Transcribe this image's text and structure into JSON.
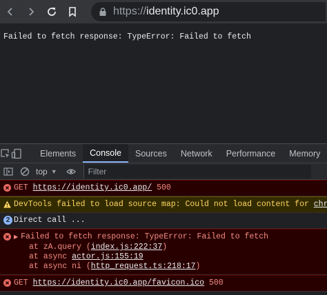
{
  "browser": {
    "url_scheme": "https://",
    "url_host": "identity.ic0.app"
  },
  "page": {
    "text": "Failed to fetch response: TypeError: Failed to fetch"
  },
  "devtools": {
    "tabs": [
      "Elements",
      "Console",
      "Sources",
      "Network",
      "Performance",
      "Memory"
    ],
    "active_tab": "Console",
    "context": "top",
    "filter_placeholder": "Filter",
    "messages": {
      "m1": {
        "method": "GET",
        "url": "https://identity.ic0.app/",
        "status": "500"
      },
      "m2": {
        "text": "DevTools failed to load source map: Could not load content for ",
        "link": "chrome-ex"
      },
      "m3": {
        "count": "2",
        "text": "Direct call ..."
      },
      "m4": {
        "text": "Failed to fetch response: TypeError: Failed to fetch",
        "s1_pre": "at zA.query (",
        "s1_link": "index.js:222:37",
        "s1_post": ")",
        "s2_pre": "at async ",
        "s2_link": "actor.js:155:19",
        "s3_pre": "at async ni (",
        "s3_link": "http_request.ts:218:17",
        "s3_post": ")"
      },
      "m5": {
        "method": "GET",
        "url": "https://identity.ic0.app/favicon.ico",
        "status": "500"
      }
    }
  },
  "colors": {
    "error": "#f28b82",
    "warning": "#fdd663",
    "accent": "#8ab4f8"
  }
}
